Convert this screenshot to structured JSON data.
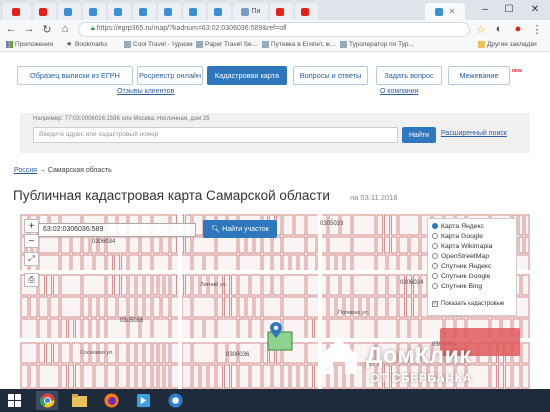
{
  "browser": {
    "tabs": [
      {
        "label": "",
        "icon": "youtube-icon",
        "color": "#e62117"
      },
      {
        "label": "",
        "icon": "youtube-icon",
        "color": "#e62117"
      },
      {
        "label": "",
        "icon": "map-pin-icon",
        "color": "#3b8fd6"
      },
      {
        "label": "",
        "icon": "map-pin-icon",
        "color": "#3b8fd6"
      },
      {
        "label": "",
        "icon": "map-pin-icon",
        "color": "#3b8fd6"
      },
      {
        "label": "",
        "icon": "map-pin-icon",
        "color": "#3b8fd6"
      },
      {
        "label": "",
        "icon": "map-pin-icon",
        "color": "#3b8fd6"
      },
      {
        "label": "",
        "icon": "map-pin-icon",
        "color": "#3b8fd6"
      },
      {
        "label": "",
        "icon": "map-pin-icon",
        "color": "#3b8fd6"
      },
      {
        "label": "Пи",
        "icon": "page-icon",
        "color": "#7a9cc6"
      },
      {
        "label": "",
        "icon": "yandex-icon",
        "color": "#e62117"
      },
      {
        "label": "",
        "icon": "yandex-icon",
        "color": "#e62117"
      },
      {
        "label": "",
        "icon": "map-pin-icon",
        "color": "#3b8fd6"
      }
    ],
    "url": "https://egrp365.ru/map/?kadnum=63:02:0306036:589&ref=ofl",
    "bookmarks": [
      "Приложения",
      "Bookmarks",
      "Cool Travel - туризм",
      "Paper Travel Se...",
      "Путевка в Египет, ж...",
      "Туроператор по Тур...",
      "Другие закладки"
    ]
  },
  "site": {
    "nav": [
      "Образец выписки из ЕГРН",
      "Росреестр онлайн",
      "Кадастровая карта",
      "Вопросы и ответы",
      "Задать вопрос",
      "Межевание"
    ],
    "nav_badge": "new",
    "sublinks": [
      "Отзывы клиентов",
      "О компании"
    ],
    "search_hint": "Например: 77:03:0006016:1596 или Москва, Неглинная, дом 25",
    "search_placeholder": "Введите адрес или кадастровый номер",
    "search_button": "Найти",
    "advanced_search": "Расширенный поиск",
    "breadcrumb_root": "Россия",
    "breadcrumb_sep": "→",
    "breadcrumb_current": "Самарская область",
    "title": "Публичная кадастровая карта Самарской области",
    "date": "на 03.11.2018"
  },
  "map": {
    "coord_value": "63:02:0306036:589",
    "find_parcels": "Найти участок",
    "layers": [
      {
        "label": "Карта Яндекс",
        "type": "radio",
        "on": true
      },
      {
        "label": "Карта Google",
        "type": "radio",
        "on": false
      },
      {
        "label": "Карта Wikimapia",
        "type": "radio",
        "on": false
      },
      {
        "label": "OpenStreetMap",
        "type": "radio",
        "on": false
      },
      {
        "label": "Спутник Яндекс",
        "type": "radio",
        "on": false
      },
      {
        "label": "Спутник Google",
        "type": "radio",
        "on": false
      },
      {
        "label": "Спутник Bing",
        "type": "radio",
        "on": false
      },
      {
        "label": "Показать кадастровые",
        "type": "check",
        "on": true
      }
    ],
    "parcel_numbers": [
      "0306034",
      "0305033",
      "0306034",
      "0305036",
      "0306036",
      "0305039"
    ],
    "street_names": [
      "Летний ул.",
      "Сосновая ул.",
      "Полевая ул."
    ]
  },
  "watermark": {
    "brand": "ДомКлик",
    "sub": "ОТ СБЕРБАНКА"
  },
  "colors": {
    "accent": "#2f77bd",
    "parcel_line": "#c86868",
    "map_bg": "#f6ecec"
  }
}
